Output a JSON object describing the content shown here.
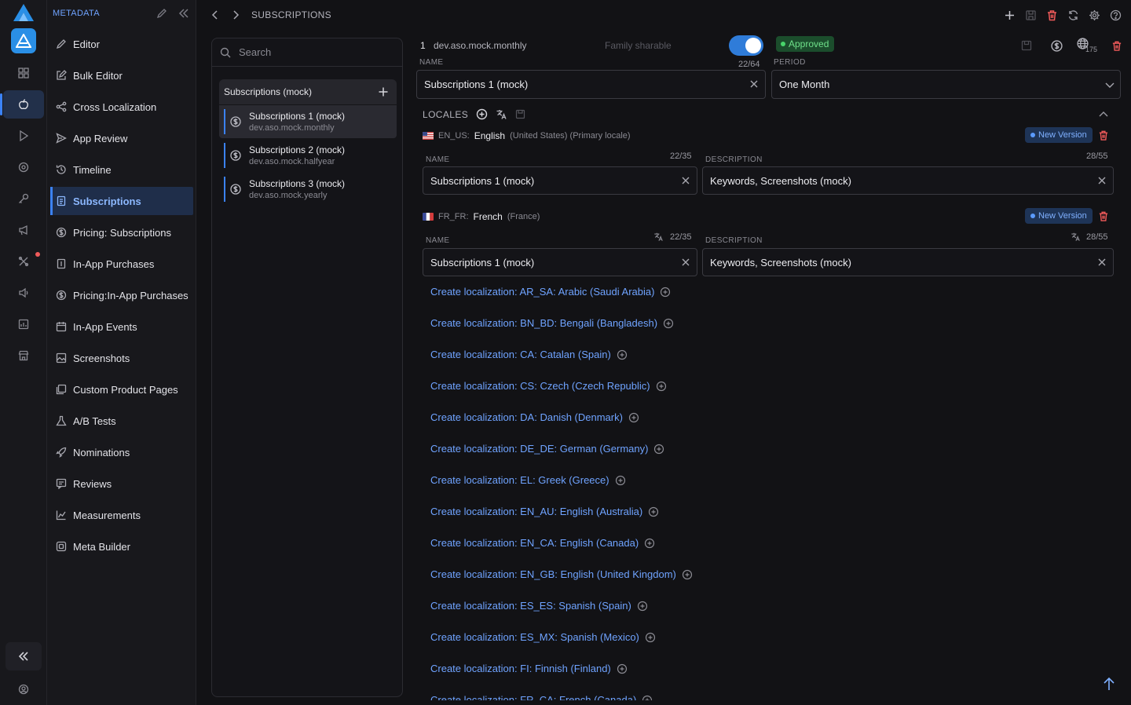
{
  "nav": {
    "header": "METADATA",
    "items": [
      {
        "label": "Editor",
        "icon": "pencil-icon"
      },
      {
        "label": "Bulk Editor",
        "icon": "edit-box-icon"
      },
      {
        "label": "Cross Localization",
        "icon": "share-nodes-icon"
      },
      {
        "label": "App Review",
        "icon": "send-icon"
      },
      {
        "label": "Timeline",
        "icon": "history-icon"
      },
      {
        "label": "Subscriptions",
        "icon": "document-icon"
      },
      {
        "label": "Pricing: Subscriptions",
        "icon": "dollar-circle-icon"
      },
      {
        "label": "In-App Purchases",
        "icon": "receipt-icon"
      },
      {
        "label": "Pricing:In-App Purchases",
        "icon": "dollar-circle-icon"
      },
      {
        "label": "In-App Events",
        "icon": "calendar-icon"
      },
      {
        "label": "Screenshots",
        "icon": "image-icon"
      },
      {
        "label": "Custom Product Pages",
        "icon": "pages-icon"
      },
      {
        "label": "A/B Tests",
        "icon": "flask-icon"
      },
      {
        "label": "Nominations",
        "icon": "rocket-icon"
      },
      {
        "label": "Reviews",
        "icon": "review-icon"
      },
      {
        "label": "Measurements",
        "icon": "chart-icon"
      },
      {
        "label": "Meta Builder",
        "icon": "cube-icon"
      }
    ]
  },
  "breadcrumb": {
    "current": "SUBSCRIPTIONS"
  },
  "list": {
    "search_placeholder": "Search",
    "group_label": "Subscriptions (mock)",
    "items": [
      {
        "name": "Subscriptions 1 (mock)",
        "id": "dev.aso.mock.monthly"
      },
      {
        "name": "Subscriptions 2 (mock)",
        "id": "dev.aso.mock.halfyear"
      },
      {
        "name": "Subscriptions 3 (mock)",
        "id": "dev.aso.mock.yearly"
      }
    ]
  },
  "detail": {
    "number": "1",
    "product_id": "dev.aso.mock.monthly",
    "family_sharable": "Family sharable",
    "status": "Approved",
    "territories_count": "175",
    "name_label": "NAME",
    "name_counter": "22/64",
    "name_value": "Subscriptions 1 (mock)",
    "period_label": "PERIOD",
    "period_value": "One Month"
  },
  "locales": {
    "title": "LOCALES",
    "entries": [
      {
        "code": "EN_US:",
        "language": "English",
        "region": "(United States) (Primary locale)",
        "badge": "New Version",
        "name_label": "NAME",
        "name_counter": "22/35",
        "name_value": "Subscriptions 1 (mock)",
        "desc_label": "DESCRIPTION",
        "desc_counter": "28/55",
        "desc_value": "Keywords, Screenshots (mock)"
      },
      {
        "code": "FR_FR:",
        "language": "French",
        "region": "(France)",
        "badge": "New Version",
        "name_label": "NAME",
        "name_counter": "22/35",
        "name_value": "Subscriptions 1 (mock)",
        "desc_label": "DESCRIPTION",
        "desc_counter": "28/55",
        "desc_value": "Keywords, Screenshots (mock)"
      }
    ],
    "create": [
      "Create localization: AR_SA: Arabic (Saudi Arabia)",
      "Create localization: BN_BD: Bengali (Bangladesh)",
      "Create localization: CA: Catalan (Spain)",
      "Create localization: CS: Czech (Czech Republic)",
      "Create localization: DA: Danish (Denmark)",
      "Create localization: DE_DE: German (Germany)",
      "Create localization: EL: Greek (Greece)",
      "Create localization: EN_AU: English (Australia)",
      "Create localization: EN_CA: English (Canada)",
      "Create localization: EN_GB: English (United Kingdom)",
      "Create localization: ES_ES: Spanish (Spain)",
      "Create localization: ES_MX: Spanish (Mexico)",
      "Create localization: FI: Finnish (Finland)",
      "Create localization: FR_CA: French (Canada)"
    ]
  },
  "colors": {
    "accent": "#3b82f6",
    "link": "#6fa3ff",
    "approved": "#48d46b",
    "danger": "#f05a5a"
  }
}
